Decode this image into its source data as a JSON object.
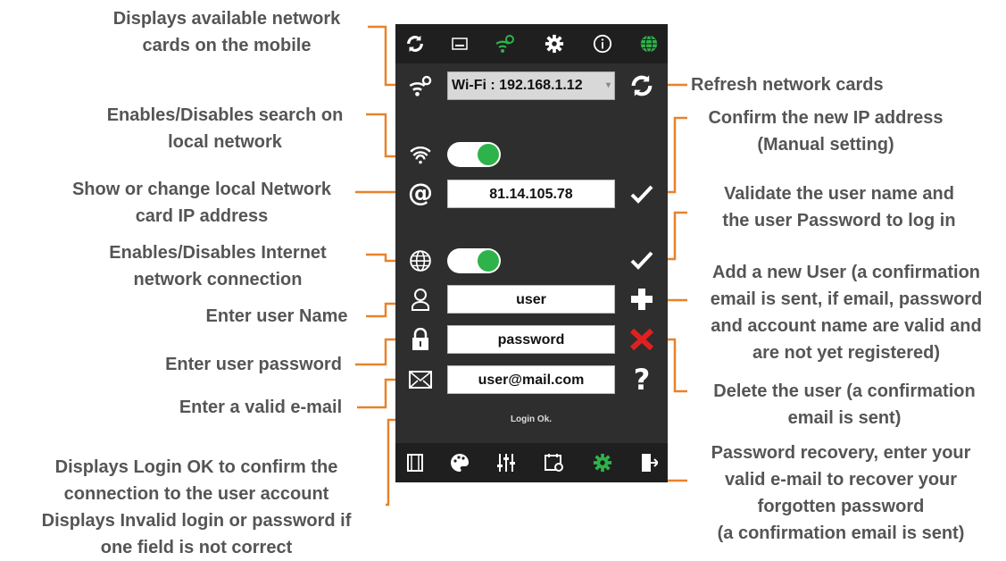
{
  "annotations": {
    "network_cards": [
      "Displays available network",
      "cards on the mobile"
    ],
    "search_local": [
      "Enables/Disables search on",
      "local network"
    ],
    "local_ip": [
      "Show or change local Network",
      "card IP address"
    ],
    "internet": [
      "Enables/Disables Internet",
      "network connection"
    ],
    "user_name": [
      "Enter user Name"
    ],
    "user_password": [
      "Enter user password"
    ],
    "email": [
      "Enter a valid e-mail"
    ],
    "login_status": [
      "Displays Login OK to confirm the",
      "connection to the user account",
      "Displays Invalid login or password if",
      "one field is not correct"
    ],
    "refresh": [
      "Refresh network cards"
    ],
    "confirm_ip": [
      "Confirm the new IP address",
      "(Manual setting)"
    ],
    "validate": [
      "Validate the user name and",
      "the user Password to log in"
    ],
    "add_user": [
      "Add a new User (a confirmation",
      "email is sent, if email, password",
      "and account name are valid and",
      "are not yet registered)"
    ],
    "delete_user": [
      "Delete the user (a confirmation",
      "email is sent)"
    ],
    "recovery": [
      "Password recovery, enter your",
      "valid e-mail to recover your",
      "forgotten password",
      "(a confirmation email is sent)"
    ]
  },
  "screen": {
    "network_select": "Wi-Fi : 192.168.1.12",
    "ip_value": "81.14.105.78",
    "user_value": "user",
    "password_value": "password",
    "email_value": "user@mail.com",
    "status": "Login Ok."
  },
  "colors": {
    "accent_green": "#2db34a",
    "annotation_line": "#e8822a",
    "delete_red": "#e02020"
  },
  "icons": {
    "top_bar": [
      "refresh-icon",
      "screen-icon",
      "wifi-settings-icon",
      "gear-icon",
      "info-icon",
      "globe-icon"
    ],
    "bottom_bar": [
      "film-icon",
      "palette-icon",
      "sliders-icon",
      "calendar-settings-icon",
      "gear-icon",
      "exit-icon"
    ]
  }
}
